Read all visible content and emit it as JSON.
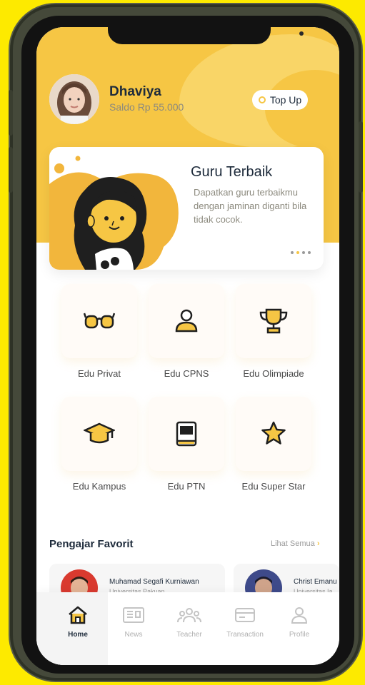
{
  "profile": {
    "name": "Dhaviya",
    "balance": "Saldo Rp 55.000",
    "topup_label": "Top Up"
  },
  "banner": {
    "title": "Guru Terbaik",
    "description": "Dapatkan guru terbaikmu dengan jaminan diganti bila tidak cocok."
  },
  "menu": [
    {
      "label": "Edu Privat",
      "icon": "glasses-icon"
    },
    {
      "label": "Edu CPNS",
      "icon": "person-icon"
    },
    {
      "label": "Edu Olimpiade",
      "icon": "trophy-icon"
    },
    {
      "label": "Edu Kampus",
      "icon": "graduation-cap-icon"
    },
    {
      "label": "Edu PTN",
      "icon": "book-icon"
    },
    {
      "label": "Edu Super Star",
      "icon": "star-icon"
    }
  ],
  "favorites": {
    "title": "Pengajar Favorit",
    "see_all": "Lihat Semua",
    "teachers": [
      {
        "name": "Muhamad Segafi Kurniawan",
        "university": "Universitas Pakuan"
      },
      {
        "name": "Christ Emanu",
        "university": "Universitas Ia"
      }
    ]
  },
  "nav": [
    {
      "label": "Home",
      "icon": "home-icon",
      "active": true
    },
    {
      "label": "News",
      "icon": "news-icon",
      "active": false
    },
    {
      "label": "Teacher",
      "icon": "teacher-icon",
      "active": false
    },
    {
      "label": "Transaction",
      "icon": "card-icon",
      "active": false
    },
    {
      "label": "Profile",
      "icon": "profile-icon",
      "active": false
    }
  ],
  "colors": {
    "background": "#FDEA00",
    "accent": "#F6C644",
    "text_dark": "#1E2B3B"
  }
}
